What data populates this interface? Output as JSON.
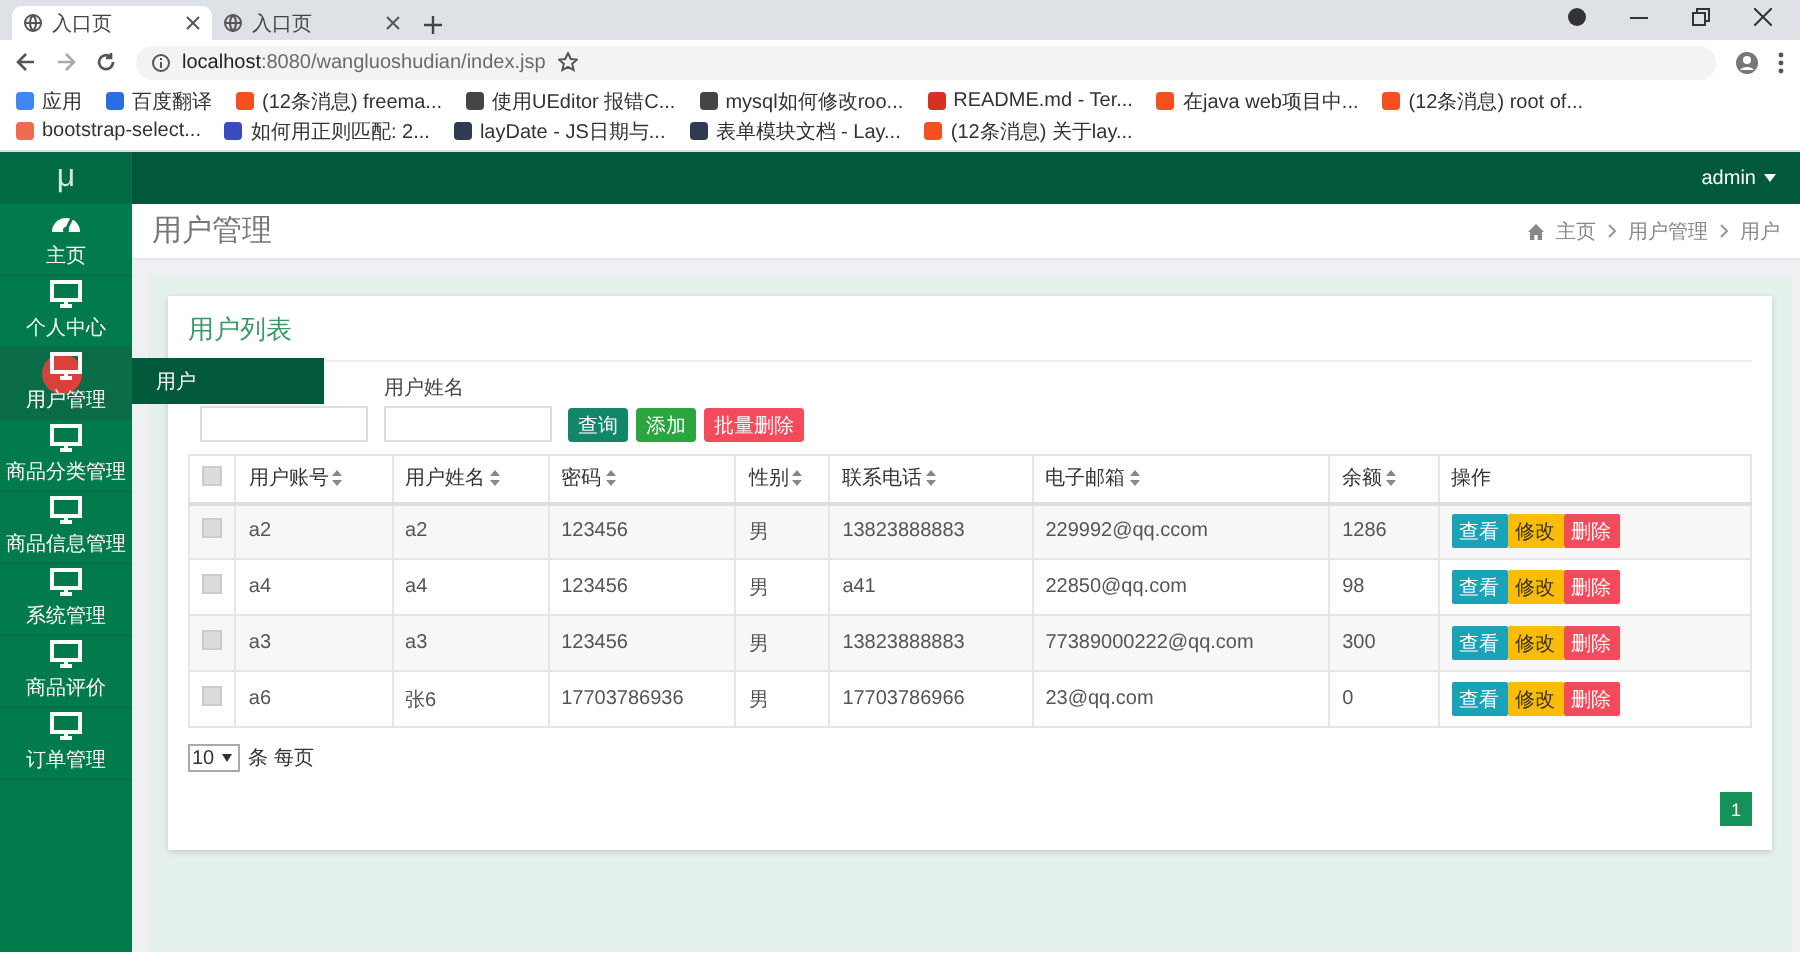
{
  "browser": {
    "tabs": [
      {
        "title": "入口页",
        "selected": true
      },
      {
        "title": "入口页",
        "selected": false
      }
    ],
    "address": {
      "host": "localhost",
      "path": ":8080/wangluoshudian/index.jsp"
    },
    "bookmarks": [
      {
        "label": "应用",
        "color": "#4285f4"
      },
      {
        "label": "百度翻译",
        "color": "#2b6de5"
      },
      {
        "label": "(12条消息) freema...",
        "color": "#f4511e"
      },
      {
        "label": "使用UEditor 报错C...",
        "color": "#444444"
      },
      {
        "label": "mysql如何修改roo...",
        "color": "#444444"
      },
      {
        "label": "README.md - Ter...",
        "color": "#d93025"
      },
      {
        "label": "在java web项目中...",
        "color": "#f4511e"
      },
      {
        "label": "(12条消息) root of...",
        "color": "#f4511e"
      },
      {
        "label": "bootstrap-select...",
        "color": "#ee6c4d"
      },
      {
        "label": "如何用正则匹配: 2...",
        "color": "#3b4cc0"
      },
      {
        "label": "layDate - JS日期与...",
        "color": "#2f3b52"
      },
      {
        "label": "表单模块文档 - Lay...",
        "color": "#2f3b52"
      },
      {
        "label": "(12条消息) 关于lay...",
        "color": "#f4511e"
      }
    ]
  },
  "app": {
    "logo": "μ",
    "user": "admin"
  },
  "sidebar": {
    "items": [
      {
        "label": "主页",
        "expanded": false
      },
      {
        "label": "个人中心",
        "expanded": false
      },
      {
        "label": "用户管理",
        "expanded": true,
        "children": [
          {
            "label": "用户"
          }
        ]
      },
      {
        "label": "商品分类管理",
        "expanded": false
      },
      {
        "label": "商品信息管理",
        "expanded": false
      },
      {
        "label": "系统管理",
        "expanded": false
      },
      {
        "label": "商品评价",
        "expanded": false
      },
      {
        "label": "订单管理",
        "expanded": false
      }
    ]
  },
  "page_title": "用户管理",
  "breadcrumb": [
    "主页",
    "用户管理",
    "用户"
  ],
  "card": {
    "title": "用户列表",
    "search": {
      "fields": [
        {
          "kind": "text"
        },
        {
          "kind": "text",
          "label": "用户姓名"
        }
      ],
      "buttons": [
        {
          "label": "查询",
          "kind": "search"
        },
        {
          "label": "添加",
          "kind": "add"
        },
        {
          "label": "批量删除",
          "kind": "delete"
        }
      ]
    },
    "table": {
      "all_checked": false,
      "columns": [
        "用户账号",
        "用户姓名",
        "密码",
        "性别",
        "联系电话",
        "电子邮箱",
        "余额",
        "操作"
      ],
      "rows": [
        {
          "checked": false,
          "cells": [
            "a2",
            "a2",
            "123456",
            "男",
            "13823888883",
            "229992@qq.ccom",
            "1286"
          ],
          "actions": [
            {
              "label": "查看",
              "kind": "view"
            },
            {
              "label": "修改",
              "kind": "edit"
            },
            {
              "label": "删除",
              "kind": "delete"
            }
          ]
        },
        {
          "checked": false,
          "cells": [
            "a4",
            "a4",
            "123456",
            "男",
            "a41",
            "22850@qq.com",
            "98"
          ],
          "actions": [
            {
              "label": "查看",
              "kind": "view"
            },
            {
              "label": "修改",
              "kind": "edit"
            },
            {
              "label": "删除",
              "kind": "delete"
            }
          ]
        },
        {
          "checked": false,
          "cells": [
            "a3",
            "a3",
            "123456",
            "男",
            "13823888883",
            "77389000222@qq.com",
            "300"
          ],
          "actions": [
            {
              "label": "查看",
              "kind": "view"
            },
            {
              "label": "修改",
              "kind": "edit"
            },
            {
              "label": "删除",
              "kind": "delete"
            }
          ]
        },
        {
          "checked": false,
          "cells": [
            "a6",
            "张6",
            "17703786936",
            "男",
            "17703786966",
            "23@qq.com",
            "0"
          ],
          "actions": [
            {
              "label": "查看",
              "kind": "view"
            },
            {
              "label": "修改",
              "kind": "edit"
            },
            {
              "label": "删除",
              "kind": "delete"
            }
          ]
        }
      ]
    },
    "page_size": "10",
    "page_size_label": "条 每页",
    "pages": [
      {
        "label": "1",
        "selected": true
      }
    ]
  }
}
